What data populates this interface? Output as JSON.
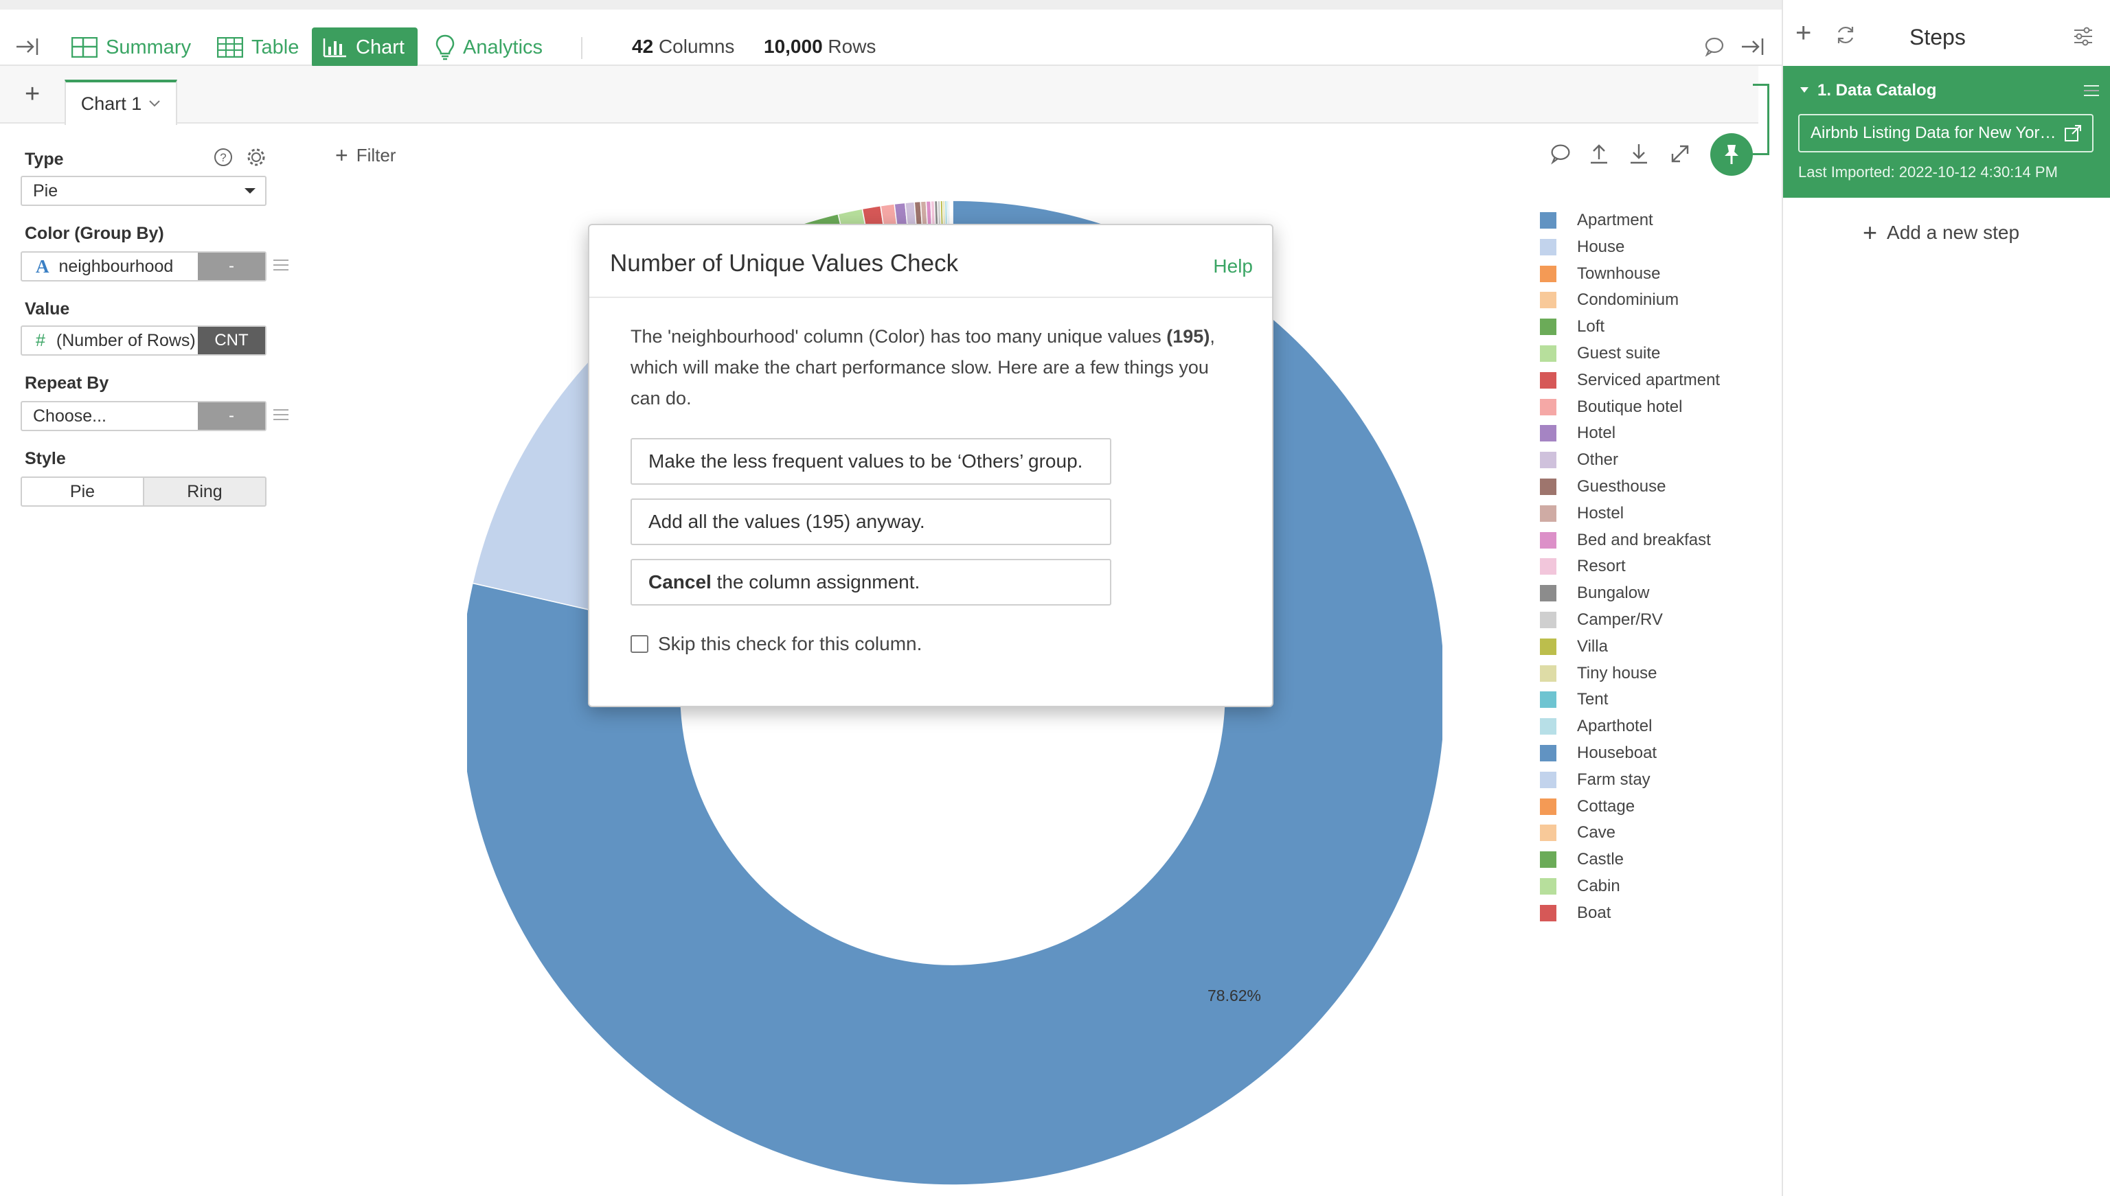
{
  "toolbar": {
    "summary": "Summary",
    "table": "Table",
    "chart": "Chart",
    "analytics": "Analytics",
    "columns_count": "42",
    "columns_label": "Columns",
    "rows_count": "10,000",
    "rows_label": "Rows",
    "accent": "#3c9e5e"
  },
  "tabs": {
    "add": "+",
    "active": "Chart 1"
  },
  "config": {
    "type_label": "Type",
    "type_value": "Pie",
    "color_label": "Color (Group By)",
    "color_type_icon": "A",
    "color_value": "neighbourhood",
    "color_tag": "-",
    "value_label": "Value",
    "value_type_icon": "#",
    "value_value": "(Number of Rows)",
    "value_tag": "CNT",
    "repeat_label": "Repeat By",
    "repeat_value": "Choose...",
    "repeat_tag": "-",
    "style_label": "Style",
    "style_options": [
      "Pie",
      "Ring"
    ],
    "style_selected": "Ring"
  },
  "chart": {
    "filter_label": "Filter",
    "slice_label": "78.62%"
  },
  "chart_data": {
    "type": "pie",
    "style": "ring",
    "categories": [
      "Apartment",
      "House",
      "Townhouse",
      "Condominium",
      "Loft",
      "Guest suite",
      "Serviced apartment",
      "Boutique hotel",
      "Hotel",
      "Other",
      "Guesthouse",
      "Hostel",
      "Bed and breakfast",
      "Resort",
      "Bungalow",
      "Camper/RV",
      "Villa",
      "Tiny house",
      "Tent",
      "Aparthotel",
      "Houseboat",
      "Farm stay",
      "Cottage",
      "Cave",
      "Castle",
      "Cabin",
      "Boat"
    ],
    "values": [
      78.62,
      11.2,
      3.4,
      1.9,
      1.2,
      0.8,
      0.6,
      0.45,
      0.35,
      0.3,
      0.2,
      0.18,
      0.15,
      0.12,
      0.1,
      0.09,
      0.08,
      0.07,
      0.06,
      0.05,
      0.04,
      0.03,
      0.02,
      0.02,
      0.01,
      0.01,
      0.01
    ],
    "colors": [
      "#6193c2",
      "#c2d3ec",
      "#f49a55",
      "#f8c999",
      "#6bab58",
      "#b7df9c",
      "#d65857",
      "#f5a8a6",
      "#a584c3",
      "#cfc1dc",
      "#9e756d",
      "#cfaba4",
      "#dc90c8",
      "#f2c6db",
      "#8c8c8c",
      "#cfcfcf",
      "#bcbe4c",
      "#dedca6",
      "#6ec4d1",
      "#b7dfe7",
      "#6193c2",
      "#c2d3ec",
      "#f49a55",
      "#f8c999",
      "#6bab58",
      "#b7df9c",
      "#d65857"
    ],
    "data_labels": [
      "78.62%"
    ],
    "legend_position": "right"
  },
  "steps": {
    "title": "Steps",
    "step_title": "1. Data Catalog",
    "source": "Airbnb Listing Data for New Yor…",
    "imported": "Last Imported: 2022-10-12 4:30:14 PM",
    "add_step": "Add a new step"
  },
  "modal": {
    "title": "Number of Unique Values Check",
    "help": "Help",
    "msg_before": "The 'neighbourhood' column (Color) has too many unique values ",
    "msg_bold": "(195)",
    "msg_after": ", which will make the chart performance slow. Here are a few things you can do.",
    "option_others": "Make the less frequent values to be ‘Others’ group.",
    "option_all": "Add all the values (195) anyway.",
    "option_cancel_bold": "Cancel",
    "option_cancel_rest": " the column assignment.",
    "skip_label": "Skip this check for this column."
  }
}
